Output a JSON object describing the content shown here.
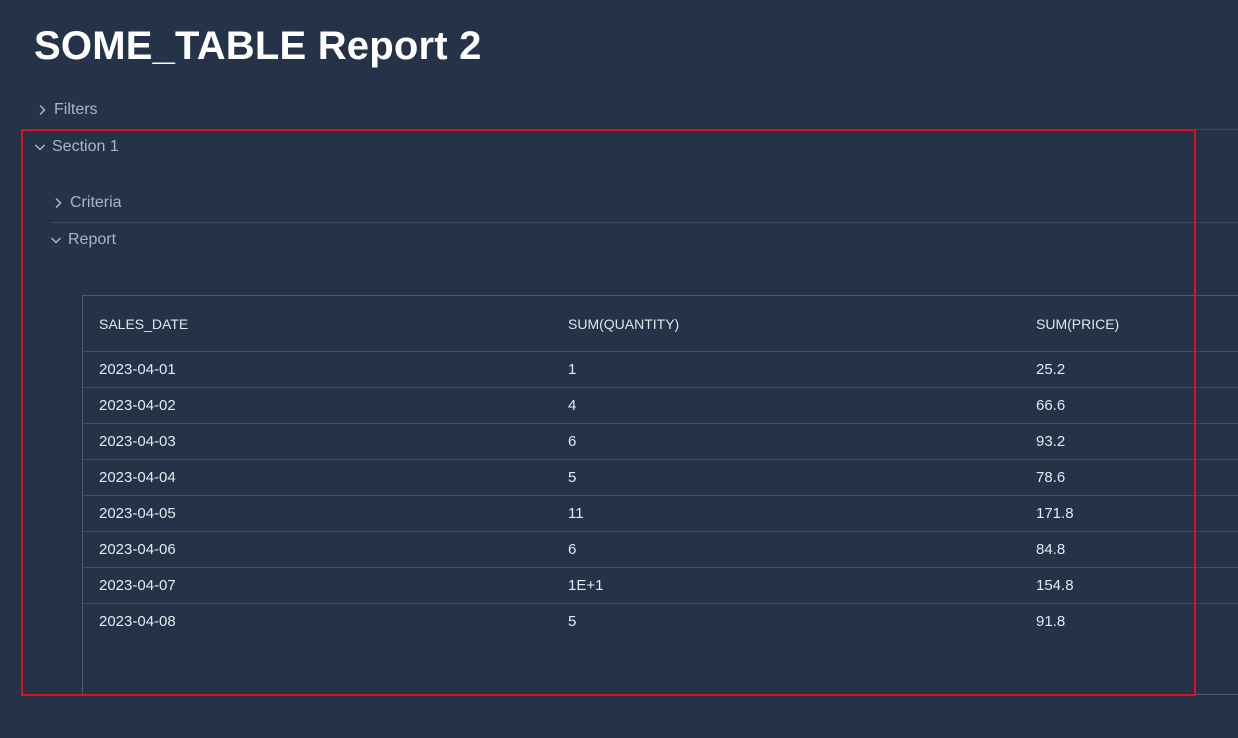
{
  "page": {
    "title": "SOME_TABLE Report 2"
  },
  "filters": {
    "label": "Filters",
    "expanded": false
  },
  "section": {
    "label": "Section 1",
    "expanded": true,
    "criteria": {
      "label": "Criteria",
      "expanded": false
    },
    "report": {
      "label": "Report",
      "expanded": true
    }
  },
  "table": {
    "columns": [
      "SALES_DATE",
      "SUM(QUANTITY)",
      "SUM(PRICE)"
    ],
    "rows": [
      [
        "2023-04-01",
        "1",
        "25.2"
      ],
      [
        "2023-04-02",
        "4",
        "66.6"
      ],
      [
        "2023-04-03",
        "6",
        "93.2"
      ],
      [
        "2023-04-04",
        "5",
        "78.6"
      ],
      [
        "2023-04-05",
        "11",
        "171.8"
      ],
      [
        "2023-04-06",
        "6",
        "84.8"
      ],
      [
        "2023-04-07",
        "1E+1",
        "154.8"
      ],
      [
        "2023-04-08",
        "5",
        "91.8"
      ]
    ]
  },
  "colors": {
    "background": "#243348",
    "highlight": "#e0101a",
    "title": "#ffffff",
    "muted_label": "#aab6c4"
  }
}
